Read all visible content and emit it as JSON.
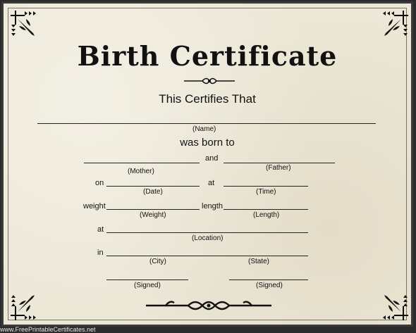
{
  "title": "Birth Certificate",
  "subtitle": "This Certifies That",
  "born_text": "was born to",
  "words": {
    "and": "and",
    "on": "on",
    "at1": "at",
    "weight": "weight",
    "length": "length",
    "at2": "at",
    "in": "in"
  },
  "labels": {
    "name": "(Name)",
    "mother": "(Mother)",
    "father": "(Father)",
    "date": "(Date)",
    "time": "(Time)",
    "weight": "(Weight)",
    "length": "(Length)",
    "location": "(Location)",
    "city": "(City)",
    "state": "(State)",
    "signed1": "(Signed)",
    "signed2": "(Signed)"
  },
  "footer": "www.FreePrintableCertificates.net"
}
